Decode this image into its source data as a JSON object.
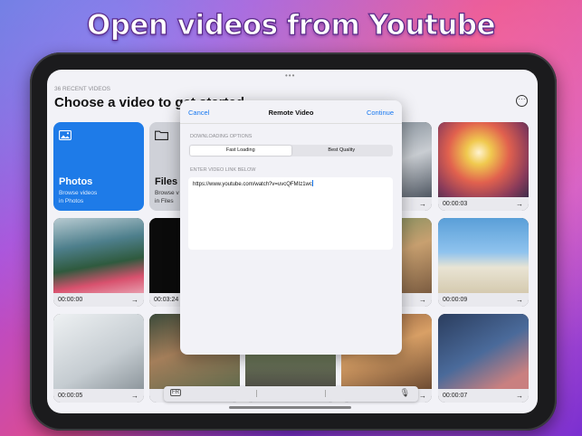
{
  "headline": "Open videos from Youtube",
  "header": {
    "recent_caption": "36 RECENT VIDEOS",
    "title": "Choose a video to get started"
  },
  "sources": [
    {
      "title": "Photos",
      "subtitle_line1": "Browse videos",
      "subtitle_line2": "in Photos",
      "icon": "photo-icon"
    },
    {
      "title": "Files",
      "subtitle_line1": "Browse v",
      "subtitle_line2": "in Files",
      "icon": "folder-icon"
    }
  ],
  "videos": [
    {
      "duration": "00:00:03"
    },
    {
      "duration": "00:00:00"
    },
    {
      "duration": "00:03:24"
    },
    {
      "duration": "00:00:09"
    },
    {
      "duration": "00:00:05"
    },
    {
      "duration": "00:00:07"
    }
  ],
  "modal": {
    "cancel": "Cancel",
    "title": "Remote Video",
    "continue": "Continue",
    "downloading_label": "DOWNLOADING OPTIONS",
    "options": [
      "Fast Loading",
      "Best Quality"
    ],
    "selected_option": "Fast Loading",
    "link_label": "ENTER VIDEO LINK BELOW",
    "link_value": "https://www.youtube.com/watch?v=uvcQFMIz1wc"
  },
  "colors": {
    "accent": "#1677f0",
    "photos_tile": "#1e7be8"
  }
}
